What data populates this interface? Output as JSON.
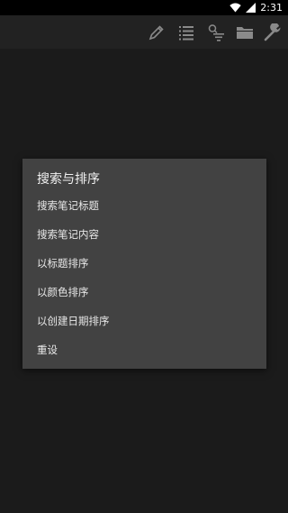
{
  "status_bar": {
    "time": "2:31",
    "icons": [
      "wifi-icon",
      "signal-icon"
    ]
  },
  "toolbar": {
    "icons": [
      "pencil-icon",
      "list-icon",
      "search-filter-icon",
      "folder-icon",
      "wrench-icon"
    ]
  },
  "dialog": {
    "title": "搜索与排序",
    "items": [
      {
        "label": "搜索笔记标题"
      },
      {
        "label": "搜索笔记内容"
      },
      {
        "label": "以标题排序"
      },
      {
        "label": "以颜色排序"
      },
      {
        "label": "以创建日期排序"
      },
      {
        "label": "重设"
      }
    ]
  },
  "colors": {
    "background": "#1b1b1b",
    "toolbar": "#222222",
    "dialog": "#424242",
    "icon": "#8a8a8a"
  }
}
